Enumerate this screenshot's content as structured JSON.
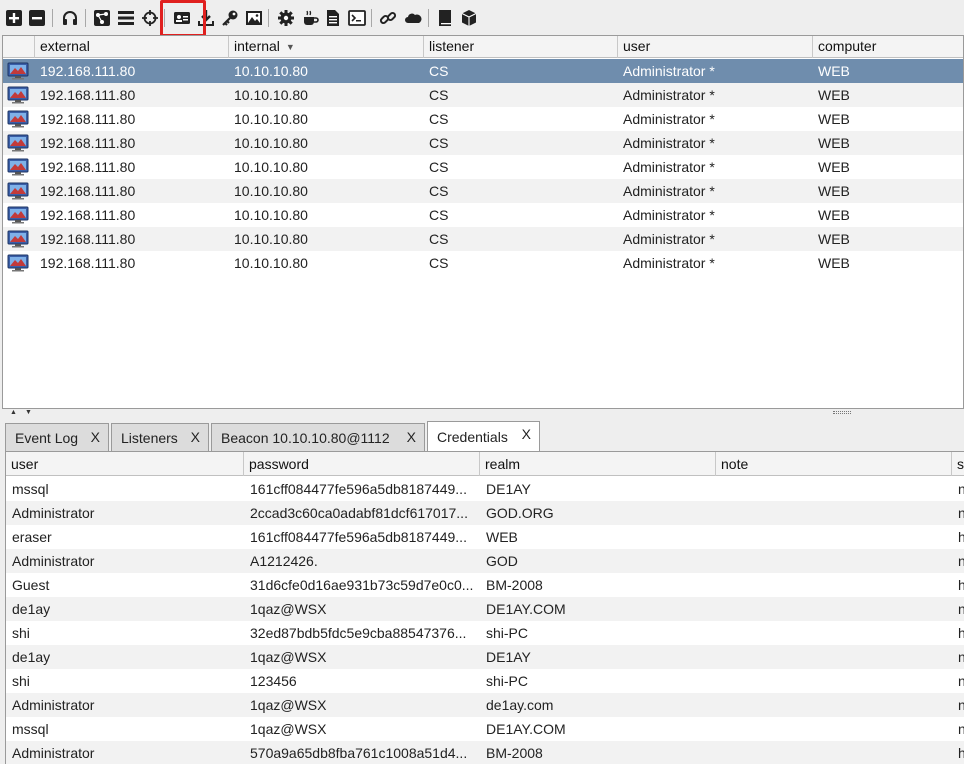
{
  "toolbar": {
    "buttons": [
      {
        "name": "connect-button",
        "icon": "plus-icon"
      },
      {
        "name": "disconnect-button",
        "icon": "minus-icon"
      },
      {
        "name": "listeners-button",
        "icon": "headphones-icon"
      },
      {
        "name": "pivot-graph-button",
        "icon": "graph-icon"
      },
      {
        "name": "session-table-button",
        "icon": "list-icon"
      },
      {
        "name": "targets-button",
        "icon": "crosshair-icon"
      },
      {
        "name": "credentials-button",
        "icon": "id-card-icon"
      },
      {
        "name": "downloads-button",
        "icon": "download-icon"
      },
      {
        "name": "keystrokes-button",
        "icon": "key-icon"
      },
      {
        "name": "screenshots-button",
        "icon": "image-icon"
      },
      {
        "name": "payload-generator-button",
        "icon": "gear-icon"
      },
      {
        "name": "java-signed-applet-button",
        "icon": "coffee-icon"
      },
      {
        "name": "office-macro-button",
        "icon": "document-icon"
      },
      {
        "name": "web-delivery-button",
        "icon": "terminal-icon"
      },
      {
        "name": "manage-web-server-button",
        "icon": "link-icon"
      },
      {
        "name": "cloud-button",
        "icon": "cloud-icon"
      },
      {
        "name": "help-button",
        "icon": "book-icon"
      },
      {
        "name": "about-button",
        "icon": "cube-icon"
      }
    ]
  },
  "sessions": {
    "columns": [
      "external",
      "internal",
      "listener",
      "user",
      "computer"
    ],
    "sorted_column": "internal",
    "rows": [
      {
        "external": "192.168.111.80",
        "internal": "10.10.10.80",
        "listener": "CS",
        "user": "Administrator *",
        "computer": "WEB"
      },
      {
        "external": "192.168.111.80",
        "internal": "10.10.10.80",
        "listener": "CS",
        "user": "Administrator *",
        "computer": "WEB"
      },
      {
        "external": "192.168.111.80",
        "internal": "10.10.10.80",
        "listener": "CS",
        "user": "Administrator *",
        "computer": "WEB"
      },
      {
        "external": "192.168.111.80",
        "internal": "10.10.10.80",
        "listener": "CS",
        "user": "Administrator *",
        "computer": "WEB"
      },
      {
        "external": "192.168.111.80",
        "internal": "10.10.10.80",
        "listener": "CS",
        "user": "Administrator *",
        "computer": "WEB"
      },
      {
        "external": "192.168.111.80",
        "internal": "10.10.10.80",
        "listener": "CS",
        "user": "Administrator *",
        "computer": "WEB"
      },
      {
        "external": "192.168.111.80",
        "internal": "10.10.10.80",
        "listener": "CS",
        "user": "Administrator *",
        "computer": "WEB"
      },
      {
        "external": "192.168.111.80",
        "internal": "10.10.10.80",
        "listener": "CS",
        "user": "Administrator *",
        "computer": "WEB"
      },
      {
        "external": "192.168.111.80",
        "internal": "10.10.10.80",
        "listener": "CS",
        "user": "Administrator *",
        "computer": "WEB"
      }
    ]
  },
  "tabs": [
    {
      "label": "Event Log",
      "close": "X"
    },
    {
      "label": "Listeners",
      "close": "X"
    },
    {
      "label": "Beacon 10.10.10.80@1112",
      "close": "X"
    },
    {
      "label": "Credentials",
      "close": "X"
    }
  ],
  "credentials": {
    "columns": [
      "user",
      "password",
      "realm",
      "note",
      "s"
    ],
    "rows": [
      {
        "user": "mssql",
        "password": "161cff084477fe596a5db8187449...",
        "realm": "DE1AY",
        "note": "",
        "s": "n"
      },
      {
        "user": "Administrator",
        "password": "2ccad3c60ca0adabf81dcf617017...",
        "realm": "GOD.ORG",
        "note": "",
        "s": "n"
      },
      {
        "user": "eraser",
        "password": "161cff084477fe596a5db8187449...",
        "realm": "WEB",
        "note": "",
        "s": "h"
      },
      {
        "user": "Administrator",
        "password": "A1212426.",
        "realm": "GOD",
        "note": "",
        "s": "n"
      },
      {
        "user": "Guest",
        "password": "31d6cfe0d16ae931b73c59d7e0c0...",
        "realm": "BM-2008",
        "note": "",
        "s": "h"
      },
      {
        "user": "de1ay",
        "password": "1qaz@WSX",
        "realm": "DE1AY.COM",
        "note": "",
        "s": "n"
      },
      {
        "user": "shi",
        "password": "32ed87bdb5fdc5e9cba88547376...",
        "realm": "shi-PC",
        "note": "",
        "s": "h"
      },
      {
        "user": "de1ay",
        "password": "1qaz@WSX",
        "realm": "DE1AY",
        "note": "",
        "s": "n"
      },
      {
        "user": "shi",
        "password": "123456",
        "realm": "shi-PC",
        "note": "",
        "s": "n"
      },
      {
        "user": "Administrator",
        "password": "1qaz@WSX",
        "realm": "de1ay.com",
        "note": "",
        "s": "n"
      },
      {
        "user": "mssql",
        "password": "1qaz@WSX",
        "realm": "DE1AY.COM",
        "note": "",
        "s": "n"
      },
      {
        "user": "Administrator",
        "password": "570a9a65db8fba761c1008a51d4...",
        "realm": "BM-2008",
        "note": "",
        "s": "h"
      }
    ]
  },
  "colors": {
    "selected_row": "#6f8dad",
    "highlight_box": "#e0201f",
    "alt_row": "#f2f2f2"
  }
}
